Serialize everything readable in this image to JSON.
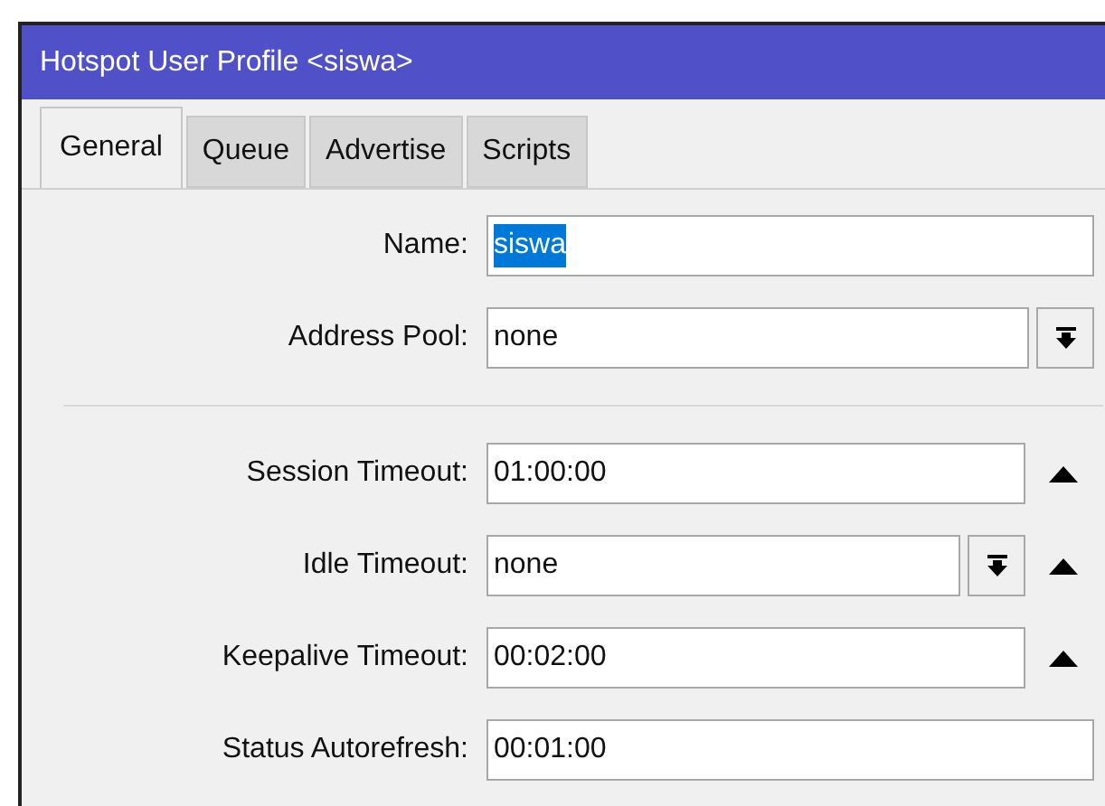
{
  "window": {
    "title": "Hotspot User Profile <siswa>"
  },
  "tabs": [
    {
      "label": "General",
      "selected": true
    },
    {
      "label": "Queue",
      "selected": false
    },
    {
      "label": "Advertise",
      "selected": false
    },
    {
      "label": "Scripts",
      "selected": false
    }
  ],
  "sections": [
    {
      "fields": [
        {
          "label": "Name:",
          "value": "siswa",
          "highlighted": true,
          "dropdown": false,
          "arrow": false
        },
        {
          "label": "Address Pool:",
          "value": "none",
          "highlighted": false,
          "dropdown": true,
          "arrow": false
        }
      ]
    },
    {
      "fields": [
        {
          "label": "Session Timeout:",
          "value": "01:00:00",
          "highlighted": false,
          "dropdown": false,
          "arrow": true
        },
        {
          "label": "Idle Timeout:",
          "value": "none",
          "highlighted": false,
          "dropdown": true,
          "arrow": true
        },
        {
          "label": "Keepalive Timeout:",
          "value": "00:02:00",
          "highlighted": false,
          "dropdown": false,
          "arrow": true
        },
        {
          "label": "Status Autorefresh:",
          "value": "00:01:00",
          "highlighted": false,
          "dropdown": false,
          "arrow": false
        }
      ]
    }
  ]
}
